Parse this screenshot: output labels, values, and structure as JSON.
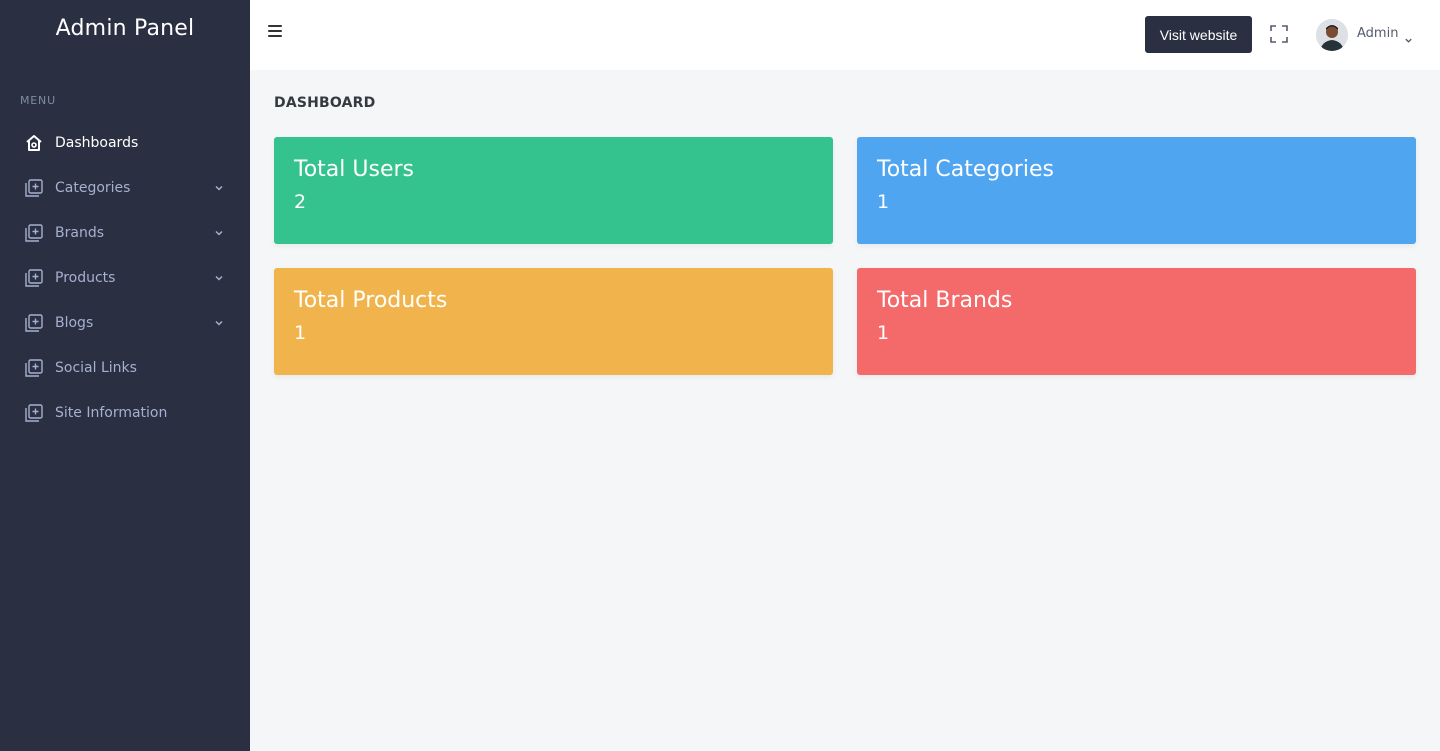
{
  "app": {
    "title": "Admin Panel"
  },
  "sidebar": {
    "menu_title": "MENU",
    "items": [
      {
        "label": "Dashboards",
        "icon": "home-icon",
        "active": true,
        "has_submenu": false
      },
      {
        "label": "Categories",
        "icon": "add-box-icon",
        "active": false,
        "has_submenu": true
      },
      {
        "label": "Brands",
        "icon": "add-box-icon",
        "active": false,
        "has_submenu": true
      },
      {
        "label": "Products",
        "icon": "add-box-icon",
        "active": false,
        "has_submenu": true
      },
      {
        "label": "Blogs",
        "icon": "add-box-icon",
        "active": false,
        "has_submenu": true
      },
      {
        "label": "Social Links",
        "icon": "add-box-icon",
        "active": false,
        "has_submenu": false
      },
      {
        "label": "Site Information",
        "icon": "add-box-icon",
        "active": false,
        "has_submenu": false
      }
    ]
  },
  "topbar": {
    "visit_label": "Visit website",
    "user_name": "Admin"
  },
  "page": {
    "title": "DASHBOARD"
  },
  "cards": [
    {
      "title": "Total Users",
      "value": "2",
      "color": "#34c38f"
    },
    {
      "title": "Total Categories",
      "value": "1",
      "color": "#50a5f1"
    },
    {
      "title": "Total Products",
      "value": "1",
      "color": "#f1b44c"
    },
    {
      "title": "Total Brands",
      "value": "1",
      "color": "#f46a6a"
    }
  ],
  "colors": {
    "sidebar_bg": "#2a3042",
    "sidebar_text": "#a6b0cf",
    "page_bg": "#f5f6f8"
  }
}
